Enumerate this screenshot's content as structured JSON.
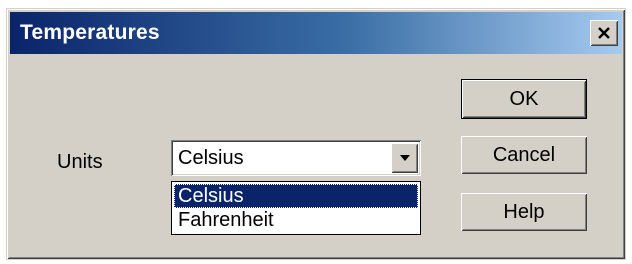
{
  "window": {
    "title": "Temperatures",
    "close_icon": "close-icon"
  },
  "form": {
    "units_label": "Units",
    "units_value": "Celsius",
    "dropdown_icon": "chevron-down-icon",
    "options": [
      "Celsius",
      "Fahrenheit"
    ],
    "selected_option": "Celsius"
  },
  "buttons": {
    "ok": "OK",
    "cancel": "Cancel",
    "help": "Help"
  },
  "colors": {
    "titlebar_start": "#0a246a",
    "titlebar_end": "#a6caf0",
    "dialog_face": "#d4d0c8",
    "selection": "#0a246a"
  }
}
